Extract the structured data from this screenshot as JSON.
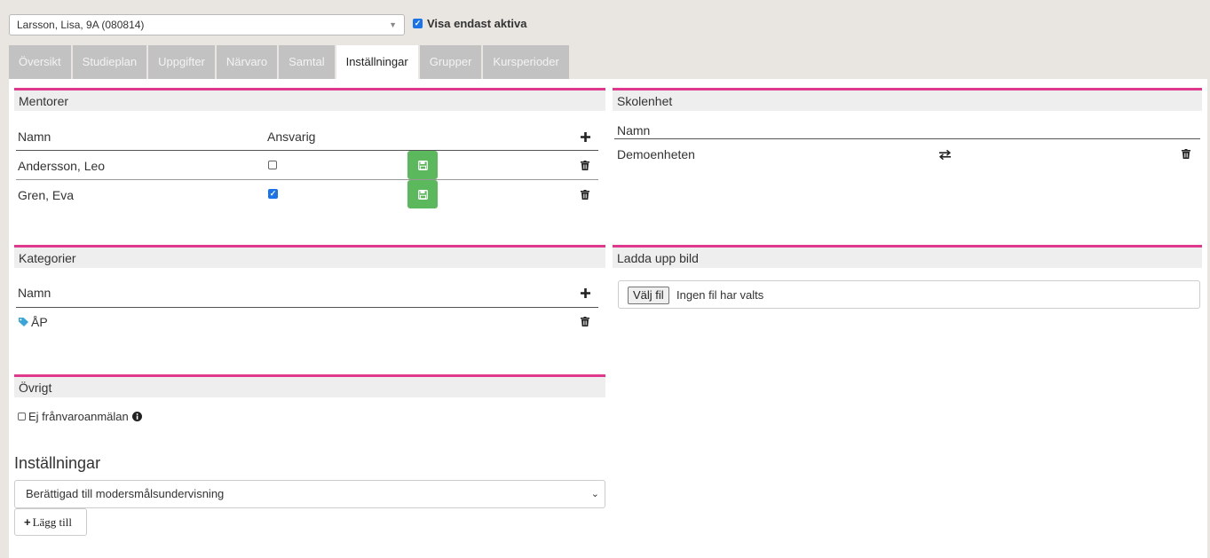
{
  "header": {
    "student_select": "Larsson, Lisa, 9A (080814)",
    "active_only_label": "Visa endast aktiva",
    "active_only_checked": true
  },
  "tabs": [
    {
      "label": "Översikt",
      "active": false
    },
    {
      "label": "Studieplan",
      "active": false
    },
    {
      "label": "Uppgifter",
      "active": false
    },
    {
      "label": "Närvaro",
      "active": false
    },
    {
      "label": "Samtal",
      "active": false
    },
    {
      "label": "Inställningar",
      "active": true
    },
    {
      "label": "Grupper",
      "active": false
    },
    {
      "label": "Kursperioder",
      "active": false
    }
  ],
  "mentors": {
    "title": "Mentorer",
    "col_name": "Namn",
    "col_responsible": "Ansvarig",
    "rows": [
      {
        "name": "Andersson, Leo",
        "responsible": false
      },
      {
        "name": "Gren, Eva",
        "responsible": true
      }
    ]
  },
  "school_unit": {
    "title": "Skolenhet",
    "col_name": "Namn",
    "rows": [
      {
        "name": "Demoenheten"
      }
    ]
  },
  "categories": {
    "title": "Kategorier",
    "col_name": "Namn",
    "rows": [
      {
        "name": "ÅP"
      }
    ]
  },
  "upload": {
    "title": "Ladda upp bild",
    "choose_button": "Välj fil",
    "status": "Ingen fil har valts"
  },
  "other": {
    "title": "Övrigt",
    "no_absence_label": "Ej frånvaroanmälan",
    "no_absence_checked": false
  },
  "settings": {
    "title": "Inställningar",
    "selected": "Berättigad till modersmålsundervisning",
    "add_label": "Lägg till"
  },
  "colors": {
    "accent": "#e0388c",
    "save_green": "#5cb85c",
    "tag_blue": "#3aa5d8"
  }
}
